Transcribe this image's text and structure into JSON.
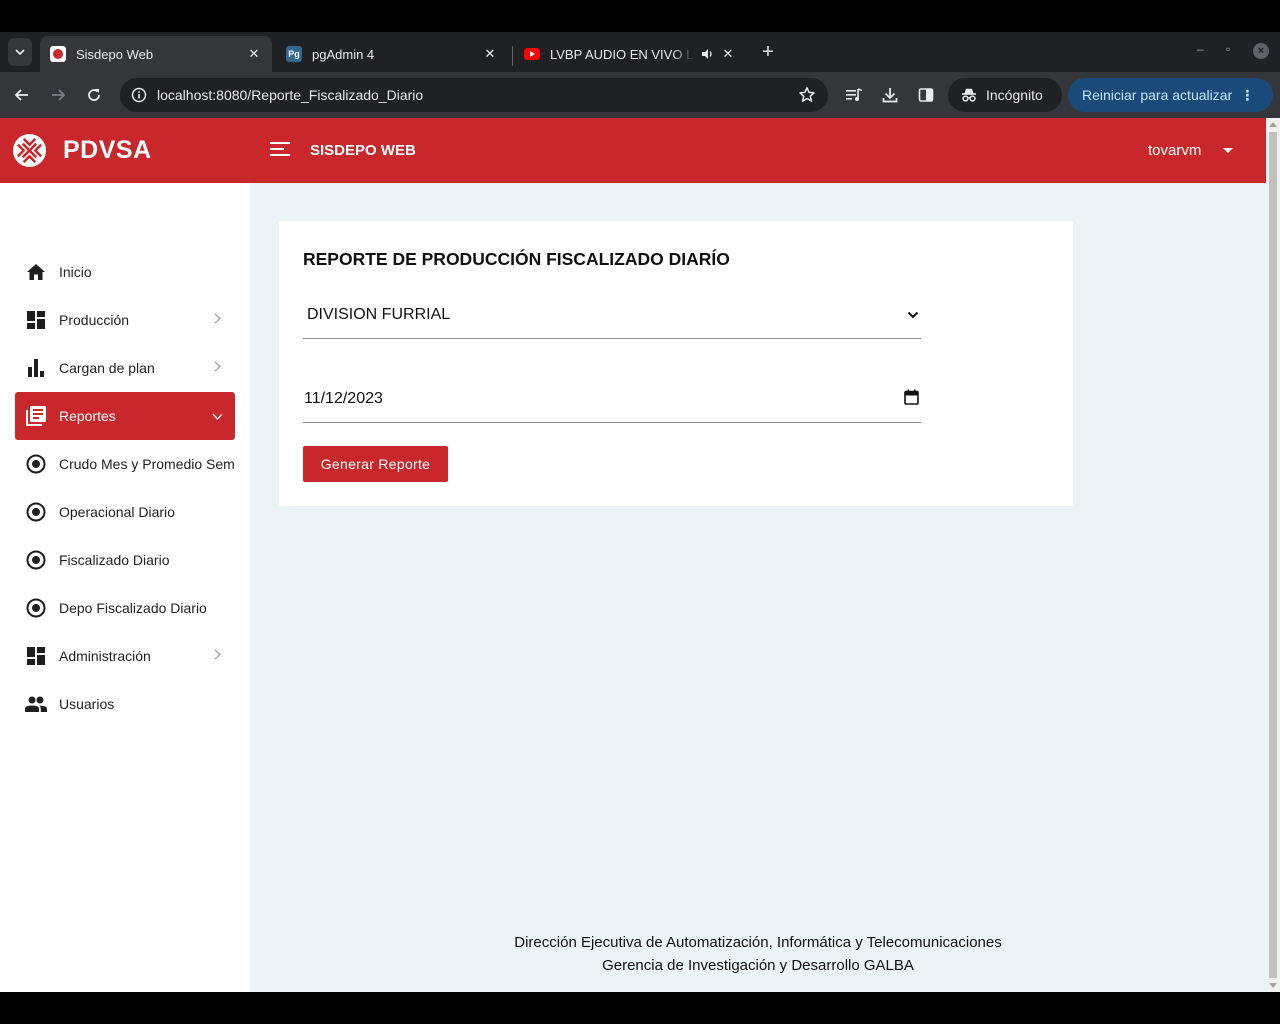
{
  "browser": {
    "tabs": [
      {
        "title": "Sisdepo Web",
        "favicon": "pdvsa-favicon",
        "active": true
      },
      {
        "title": "pgAdmin 4",
        "favicon": "pgadmin-favicon",
        "active": false
      },
      {
        "title": "LVBP AUDIO EN VIVO Leo",
        "favicon": "youtube-favicon",
        "active": false
      }
    ],
    "url_host": "localhost",
    "url_path": ":8080/Reporte_Fiscalizado_Diario",
    "incognito_label": "Incógnito",
    "update_label": "Reiniciar para actualizar"
  },
  "header": {
    "logo_text": "PDVSA",
    "app_title": "SISDEPO WEB",
    "user": "tovarvm"
  },
  "sidebar": {
    "items": [
      {
        "label": "Inicio",
        "icon": "home-icon"
      },
      {
        "label": "Producción",
        "icon": "dashboard-icon"
      },
      {
        "label": "Cargan de plan",
        "icon": "bar-chart-icon"
      },
      {
        "label": "Reportes",
        "icon": "reports-icon"
      },
      {
        "label": "Crudo Mes y Promedio Sem",
        "icon": "radio-icon"
      },
      {
        "label": "Operacional Diario",
        "icon": "radio-icon"
      },
      {
        "label": "Fiscalizado Diario",
        "icon": "radio-icon"
      },
      {
        "label": "Depo Fiscalizado Diario",
        "icon": "radio-icon"
      },
      {
        "label": "Administración",
        "icon": "dashboard-icon"
      },
      {
        "label": "Usuarios",
        "icon": "people-icon"
      }
    ]
  },
  "report": {
    "title": "REPORTE DE PRODUCCIÓN FISCALIZADO DIARÍO",
    "division_value": "DIVISION FURRIAL",
    "date_value": "11/12/2023",
    "generate_label": "Generar Reporte"
  },
  "footer": {
    "line1": "Dirección Ejecutiva de Automatización, Informática y Telecomunicaciones",
    "line2": "Gerencia de Investigación y Desarrollo GALBA"
  },
  "colors": {
    "brand_red": "#c8282b",
    "page_bg": "#eaf3f5"
  }
}
